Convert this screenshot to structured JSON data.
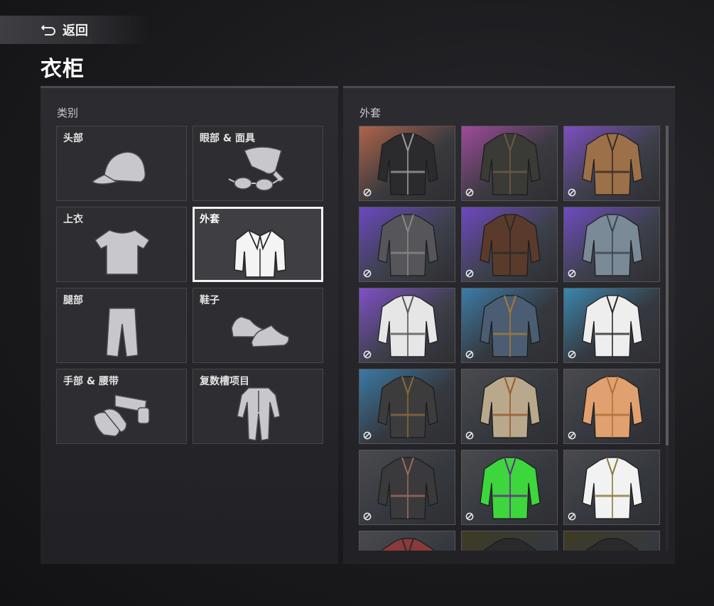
{
  "header": {
    "back_label": "返回",
    "title": "衣柜"
  },
  "categories_panel": {
    "heading": "类别",
    "items": [
      {
        "label": "头部",
        "icon": "cap-icon",
        "selected": false
      },
      {
        "label": "眼部 & 面具",
        "icon": "sunglasses-bandana-icon",
        "selected": false
      },
      {
        "label": "上衣",
        "icon": "tshirt-icon",
        "selected": false
      },
      {
        "label": "外套",
        "icon": "jacket-icon",
        "selected": true
      },
      {
        "label": "腿部",
        "icon": "pants-icon",
        "selected": false
      },
      {
        "label": "鞋子",
        "icon": "sneakers-icon",
        "selected": false
      },
      {
        "label": "手部 & 腰带",
        "icon": "gloves-belt-icon",
        "selected": false
      },
      {
        "label": "复数槽项目",
        "icon": "jumpsuit-icon",
        "selected": false
      }
    ]
  },
  "items_panel": {
    "heading": "外套",
    "items": [
      {
        "name": "leather-dress-jacket",
        "bg": "#b0644a",
        "bg2": "#3a3a3e",
        "color": "#2b2b2d",
        "accent": "#9a9a9a",
        "locked": true
      },
      {
        "name": "dark-biker-jacket",
        "bg": "#a04a9c",
        "bg2": "#3a3a40",
        "color": "#3a3a36",
        "accent": "#6b5a40",
        "locked": true
      },
      {
        "name": "tan-field-coat",
        "bg": "#7d4fc0",
        "bg2": "#3c3f48",
        "color": "#9c7048",
        "accent": "#3a2c22",
        "locked": true
      },
      {
        "name": "grey-puffer-vest",
        "bg": "#6b48c0",
        "bg2": "#3c404a",
        "color": "#55555a",
        "accent": "#888888",
        "locked": true
      },
      {
        "name": "brown-hooded-leather",
        "bg": "#6e48c0",
        "bg2": "#3c404a",
        "color": "#5a3a2a",
        "accent": "#2a2a2a",
        "locked": true
      },
      {
        "name": "denim-jacket",
        "bg": "#6e4cc0",
        "bg2": "#3c404a",
        "color": "#7a8a96",
        "accent": "#3a4450",
        "locked": true
      },
      {
        "name": "white-puffer-jacket",
        "bg": "#8050c8",
        "bg2": "#3c3f48",
        "color": "#e6e6e6",
        "accent": "#555555",
        "locked": true
      },
      {
        "name": "patched-denim-vest",
        "bg": "#3c7ca8",
        "bg2": "#35393f",
        "color": "#4a5d72",
        "accent": "#a57a3a",
        "locked": true
      },
      {
        "name": "white-track-jacket",
        "bg": "#3a86ae",
        "bg2": "#35393f",
        "color": "#eeeeee",
        "accent": "#2a2a2a",
        "locked": true
      },
      {
        "name": "tactical-shirt",
        "bg": "#3a7aa6",
        "bg2": "#35393f",
        "color": "#3c3c3c",
        "accent": "#8a6a3a",
        "locked": true
      },
      {
        "name": "bandolier-coat",
        "bg": "#4a4a4e",
        "bg2": "#35393f",
        "color": "#b9a88c",
        "accent": "#9a5a2a",
        "locked": true
      },
      {
        "name": "muscle-suit",
        "bg": "#4a4a4e",
        "bg2": "#35393f",
        "color": "#e0a070",
        "accent": "#b0703a",
        "locked": true
      },
      {
        "name": "leather-vest-fur",
        "bg": "#4a4a4e",
        "bg2": "#35393f",
        "color": "#3a3a3c",
        "accent": "#9a6a5a",
        "locked": true
      },
      {
        "name": "green-hoodie",
        "bg": "#4a4a4e",
        "bg2": "#35393f",
        "color": "#3dd63d",
        "accent": "#6a2a8a",
        "locked": true
      },
      {
        "name": "white-martial-robe",
        "bg": "#4a4a4e",
        "bg2": "#35393f",
        "color": "#f2f2f2",
        "accent": "#8a7a3a",
        "locked": true
      },
      {
        "name": "red-hood-partial",
        "bg": "#4a4a4e",
        "bg2": "#35393f",
        "color": "#8a3a3a",
        "accent": "#2a2a2a",
        "locked": false
      },
      {
        "name": "dark-jacket-partial",
        "bg": "#3e3a22",
        "bg2": "#35393f",
        "color": "#2a2a2a",
        "accent": "#2a2a2a",
        "locked": false
      },
      {
        "name": "dark-coat-partial",
        "bg": "#3e3a22",
        "bg2": "#35393f",
        "color": "#2a2a2a",
        "accent": "#2a2a2a",
        "locked": false
      }
    ]
  }
}
